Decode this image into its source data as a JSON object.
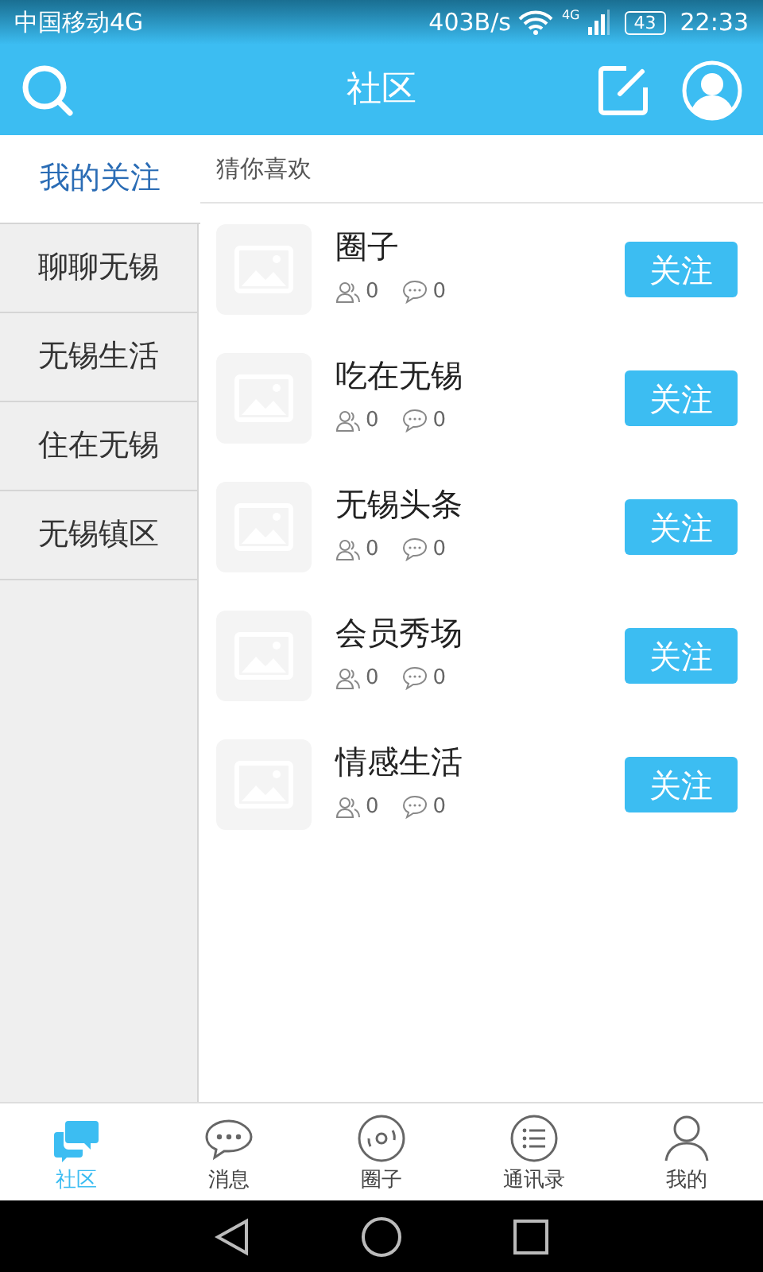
{
  "status_bar": {
    "carrier": "中国移动4G",
    "speed": "403B/s",
    "network": "4G",
    "battery": "43",
    "time": "22:33"
  },
  "header": {
    "title": "社区"
  },
  "sidebar": {
    "items": [
      {
        "label": "我的关注",
        "selected": true
      },
      {
        "label": "聊聊无锡",
        "selected": false
      },
      {
        "label": "无锡生活",
        "selected": false
      },
      {
        "label": "住在无锡",
        "selected": false
      },
      {
        "label": "无锡镇区",
        "selected": false
      }
    ]
  },
  "section_title": "猜你喜欢",
  "groups": [
    {
      "name": "圈子",
      "members": "0",
      "posts": "0",
      "button": "关注"
    },
    {
      "name": "吃在无锡",
      "members": "0",
      "posts": "0",
      "button": "关注"
    },
    {
      "name": "无锡头条",
      "members": "0",
      "posts": "0",
      "button": "关注"
    },
    {
      "name": "会员秀场",
      "members": "0",
      "posts": "0",
      "button": "关注"
    },
    {
      "name": "情感生活",
      "members": "0",
      "posts": "0",
      "button": "关注"
    }
  ],
  "tabs": [
    {
      "label": "社区",
      "kind": "chat",
      "selected": true
    },
    {
      "label": "消息",
      "kind": "message",
      "selected": false
    },
    {
      "label": "圈子",
      "kind": "disc",
      "selected": false
    },
    {
      "label": "通讯录",
      "kind": "list",
      "selected": false
    },
    {
      "label": "我的",
      "kind": "person",
      "selected": false
    }
  ]
}
